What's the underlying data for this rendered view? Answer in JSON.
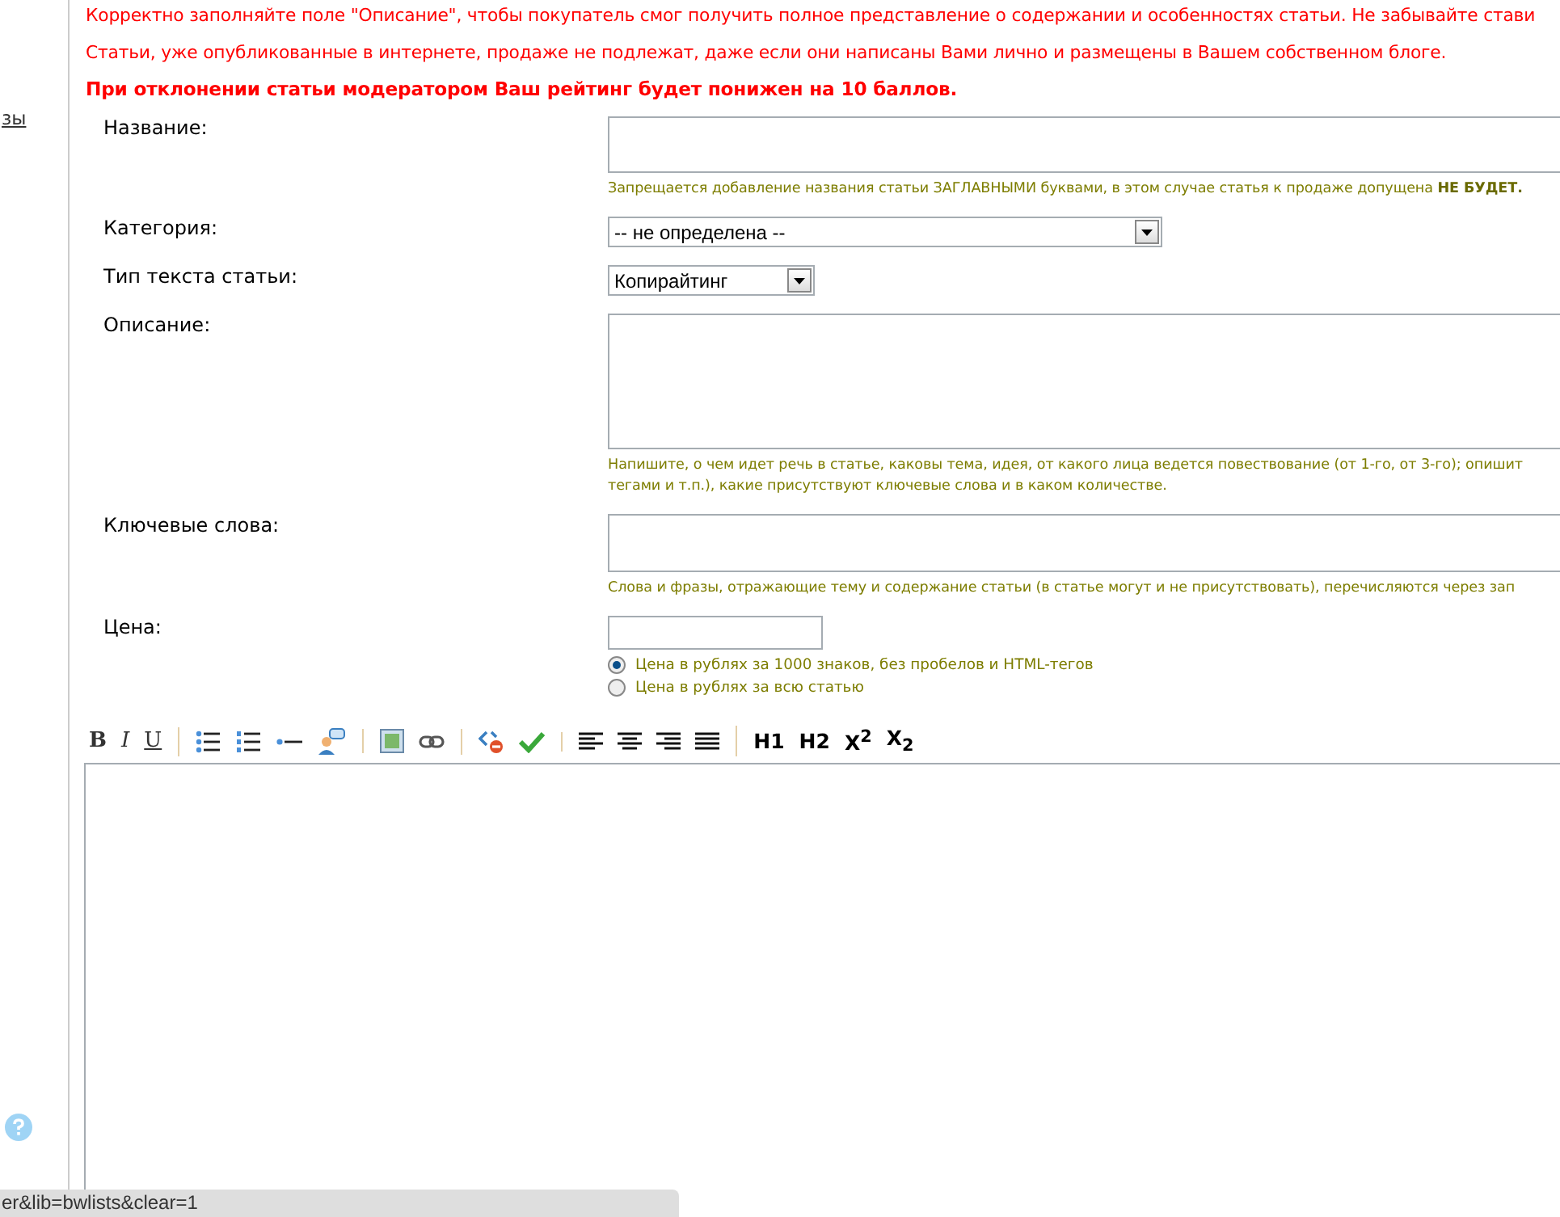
{
  "notices": [
    {
      "text": "Корректно заполняйте поле \"Описание\", чтобы покупатель смог получить полное представление о содержании и особенностях статьи. Не забывайте стави",
      "bold": false
    },
    {
      "text": "Статьи, уже опубликованные в интернете, продаже не подлежат, даже если они написаны Вами лично и размещены в Вашем собственном блоге.",
      "bold": false
    },
    {
      "text": "При отклонении статьи модератором Ваш рейтинг будет понижен на 10 баллов.",
      "bold": true
    }
  ],
  "sidebar": {
    "link": "зы"
  },
  "form": [
    {
      "label": "Название:",
      "kind": "text",
      "hint_lines": [
        "Запрещается добавление названия статьи ЗАГЛАВНЫМИ буквами, в этом случае статья к продаже допущена **НЕ БУДЕТ.**"
      ]
    },
    {
      "label": "Категория:",
      "kind": "select",
      "value": "-- не определена --"
    },
    {
      "label": "Тип текста статьи:",
      "kind": "select_short",
      "value": "Копирайтинг"
    },
    {
      "label": "Описание:",
      "kind": "textarea",
      "hint_lines": [
        "Напишите, о чем идет речь в статье, каковы тема, идея, от какого лица ведется повествование (от 1-го, от 3-го); опишит",
        "тегами и т.п.), какие присутствуют ключевые слова и в каком количестве."
      ]
    },
    {
      "label": "Ключевые слова:",
      "kind": "textarea_short",
      "hint_lines": [
        "Слова и фразы, отражающие тему и содержание статьи (в статье могут и не присутствовать), перечисляются через зап"
      ]
    },
    {
      "label": "Цена:",
      "kind": "price",
      "options": [
        {
          "label": "Цена в рублях за 1000 знаков, без пробелов и HTML-тегов",
          "selected": true
        },
        {
          "label": "Цена в рублях за всю статью",
          "selected": false
        }
      ]
    }
  ],
  "toolbar": [
    [
      {
        "kind": "bold",
        "text": "B"
      },
      {
        "kind": "italic",
        "text": "I"
      },
      {
        "kind": "underline",
        "text": "U"
      }
    ],
    [
      {
        "kind": "bullets"
      },
      {
        "kind": "numbers"
      },
      {
        "kind": "rule"
      },
      {
        "kind": "person"
      }
    ],
    [
      {
        "kind": "image"
      },
      {
        "kind": "link"
      }
    ],
    [
      {
        "kind": "code"
      },
      {
        "kind": "check"
      }
    ],
    [
      {
        "kind": "align-left"
      },
      {
        "kind": "align-center"
      },
      {
        "kind": "align-right"
      },
      {
        "kind": "justify"
      }
    ],
    [
      {
        "kind": "heading",
        "text": "H1"
      },
      {
        "kind": "heading",
        "text": "H2"
      },
      {
        "kind": "heading",
        "text": "X$^{2}$"
      },
      {
        "kind": "heading",
        "text": "X$_{2}$"
      }
    ]
  ],
  "status_bar": "er&lib=bwlists&clear=1"
}
